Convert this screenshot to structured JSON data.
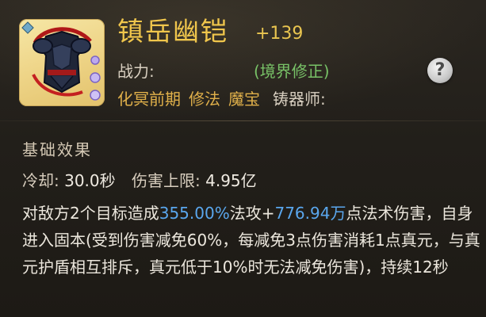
{
  "item": {
    "name": "镇岳幽铠",
    "level": "+139",
    "icon": "armor-icon",
    "card_color": "#f0d68c"
  },
  "power": {
    "label": "战力:",
    "note": "(境界修正)"
  },
  "help_button": {
    "label": "?"
  },
  "tags": {
    "realm": "化冥前期",
    "type": "修法",
    "category": "魔宝",
    "craftsman_label": "铸器师:"
  },
  "effects": {
    "section_title": "基础效果",
    "cooldown_label": "冷却:",
    "cooldown_value": "30.0秒",
    "damage_cap_label": "伤害上限:",
    "damage_cap_value": "4.95亿",
    "desc_part1": "对敌方2个目标造成",
    "desc_value1": "355.00%",
    "desc_part2": "法攻+",
    "desc_value2": "776.94万",
    "desc_part3": "点法术伤害，自身进入固本(受到伤害减免60%，每减免3点伤害消耗1点真元，与真元护盾相互排斥，真元低于10%时无法减免伤害)，持续12秒"
  },
  "colors": {
    "name": "#f0c64c",
    "highlight": "#5aa7ee",
    "green_note": "#78c267",
    "tag_gold": "#e0b04a"
  }
}
